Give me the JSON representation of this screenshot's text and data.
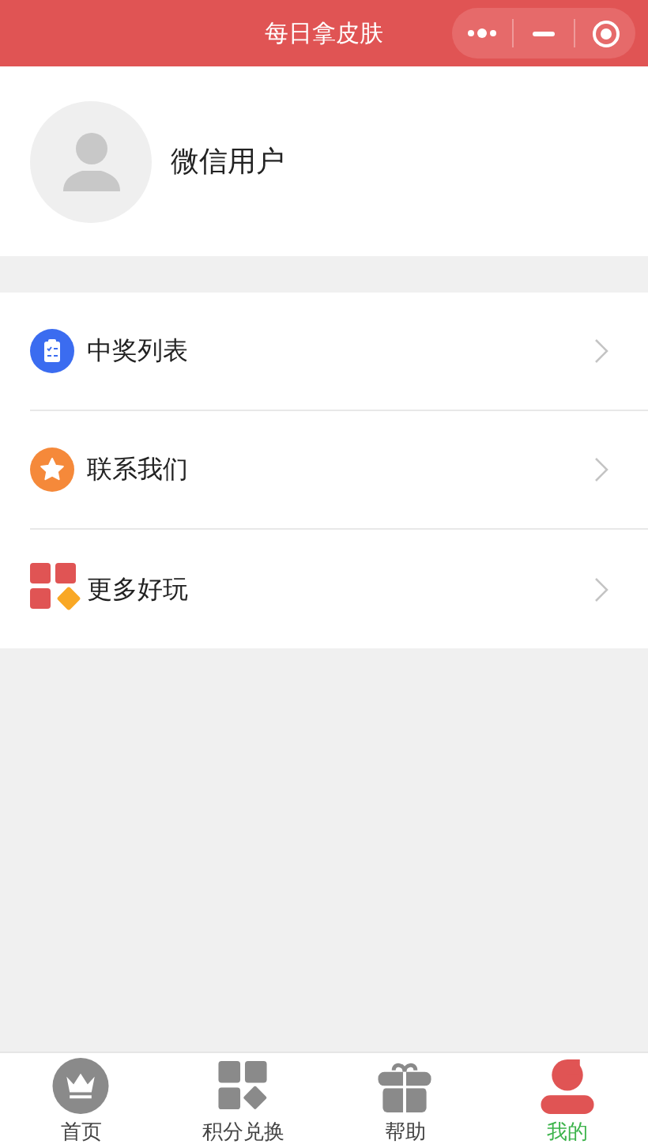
{
  "header": {
    "title": "每日拿皮肤"
  },
  "profile": {
    "name": "微信用户"
  },
  "menu": [
    {
      "kind": "list",
      "label": "中奖列表"
    },
    {
      "kind": "star",
      "label": "联系我们"
    },
    {
      "kind": "apps",
      "label": "更多好玩"
    }
  ],
  "tab_bar": [
    {
      "kind": "crown",
      "label": "首页",
      "selected": false
    },
    {
      "kind": "apps",
      "label": "积分兑换",
      "selected": false
    },
    {
      "kind": "gift",
      "label": "帮助",
      "selected": false
    },
    {
      "kind": "person",
      "label": "我的",
      "selected": true
    }
  ]
}
